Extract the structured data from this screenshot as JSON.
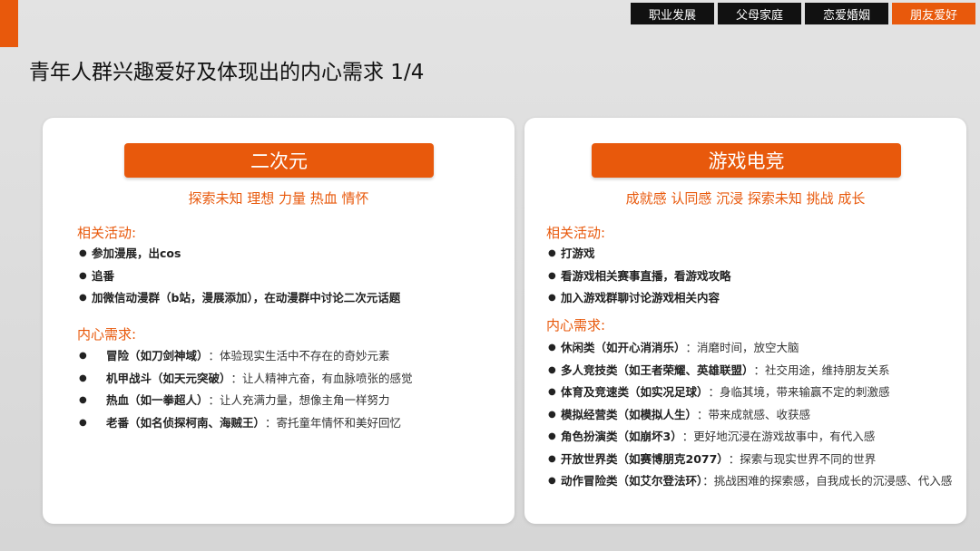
{
  "nav": {
    "tabs": [
      {
        "label": "职业发展",
        "active": false
      },
      {
        "label": "父母家庭",
        "active": false
      },
      {
        "label": "恋爱婚姻",
        "active": false
      },
      {
        "label": "朋友爱好",
        "active": true
      }
    ]
  },
  "page": {
    "title": "青年人群兴趣爱好及体现出的内心需求 1/4"
  },
  "left": {
    "header": "二次元",
    "keywords": "探索未知 理想 力量 热血 情怀",
    "activities_label": "相关活动:",
    "activities": [
      "参加漫展，出cos",
      "追番",
      "加微信动漫群（b站，漫展添加），在动漫群中讨论二次元话题"
    ],
    "needs_label": "内心需求:",
    "needs": [
      {
        "title": "冒险（如刀剑神域）",
        "desc": "：体验现实生活中不存在的奇妙元素"
      },
      {
        "title": "机甲战斗（如天元突破）",
        "desc": "：让人精神亢奋，有血脉喷张的感觉"
      },
      {
        "title": "热血（如一拳超人）",
        "desc": "：让人充满力量，想像主角一样努力"
      },
      {
        "title": "老番（如名侦探柯南、海贼王）",
        "desc": "：寄托童年情怀和美好回忆"
      }
    ]
  },
  "right": {
    "header": "游戏电竞",
    "keywords": "成就感 认同感 沉浸 探索未知 挑战 成长",
    "activities_label": "相关活动:",
    "activities": [
      "打游戏",
      "看游戏相关赛事直播，看游戏攻略",
      "加入游戏群聊讨论游戏相关内容"
    ],
    "needs_label": "内心需求:",
    "needs": [
      {
        "title": "休闲类（如开心消消乐）",
        "desc": "：消磨时间，放空大脑"
      },
      {
        "title": "多人竞技类（如王者荣耀、英雄联盟）",
        "desc": "：社交用途，维持朋友关系"
      },
      {
        "title": "体育及竞速类（如实况足球）",
        "desc": "：身临其境，带来输赢不定的刺激感"
      },
      {
        "title": "模拟经营类（如模拟人生）",
        "desc": "：带来成就感、收获感"
      },
      {
        "title": "角色扮演类（如崩坏3）",
        "desc": "：更好地沉浸在游戏故事中，有代入感"
      },
      {
        "title": "开放世界类（如赛博朋克2077）",
        "desc": "：探索与现实世界不同的世界"
      },
      {
        "title": "动作冒险类（如艾尔登法环）",
        "desc": "：挑战困难的探索感，自我成长的沉浸感、代入感"
      }
    ]
  }
}
